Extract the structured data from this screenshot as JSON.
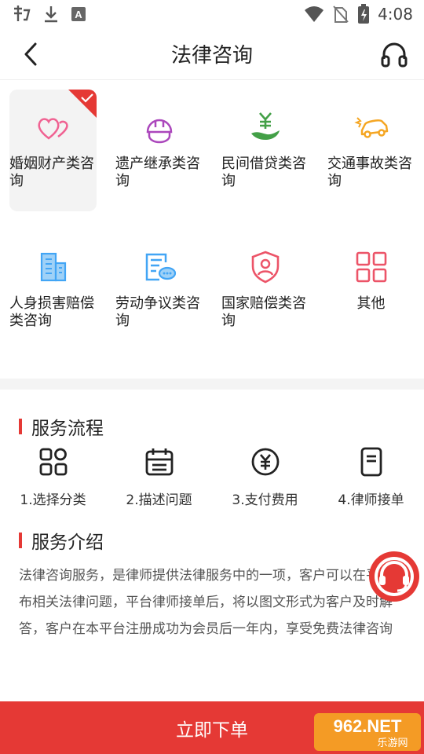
{
  "status_bar": {
    "time": "4:08"
  },
  "header": {
    "title": "法律咨询"
  },
  "categories": [
    {
      "label": "婚姻财产类咨询",
      "icon": "hearts-icon",
      "selected": true
    },
    {
      "label": "遗产继承类咨询",
      "icon": "helmet-icon",
      "selected": false
    },
    {
      "label": "民间借贷类咨询",
      "icon": "yuan-hand-icon",
      "selected": false
    },
    {
      "label": "交通事故类咨询",
      "icon": "car-crash-icon",
      "selected": false
    },
    {
      "label": "人身损害赔偿类咨询",
      "icon": "building-icon",
      "selected": false
    },
    {
      "label": "劳动争议类咨询",
      "icon": "document-chat-icon",
      "selected": false
    },
    {
      "label": "国家赔偿类咨询",
      "icon": "shield-person-icon",
      "selected": false
    },
    {
      "label": "其他",
      "icon": "grid-icon",
      "selected": false
    }
  ],
  "process": {
    "title": "服务流程",
    "steps": [
      {
        "label": "1.选择分类",
        "icon": "apps-icon"
      },
      {
        "label": "2.描述问题",
        "icon": "calendar-icon"
      },
      {
        "label": "3.支付费用",
        "icon": "yuan-coin-icon"
      },
      {
        "label": "4.律师接单",
        "icon": "card-icon"
      }
    ]
  },
  "intro": {
    "title": "服务介绍",
    "text": "法律咨询服务，是律师提供法律服务中的一项，客户可以在平台发布相关法律问题，平台律师接单后，将以图文形式为客户及时解答，客户在本平台注册成功为会员后一年内，享受免费法律咨询"
  },
  "bottom": {
    "button_label": "立即下单"
  },
  "watermark": {
    "text": "962.NET",
    "subtext": "乐游网"
  },
  "colors": {
    "accent": "#e53935",
    "pink": "#f06292",
    "purple": "#ab47bc",
    "green": "#43a047",
    "orange": "#f5a623",
    "blue": "#42a5f5"
  }
}
